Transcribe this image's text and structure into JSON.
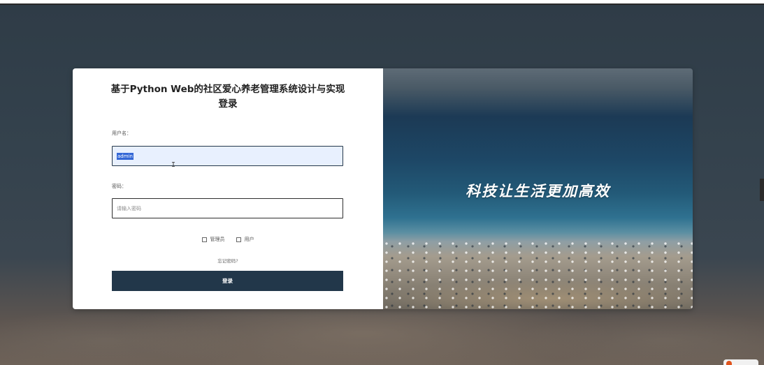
{
  "form": {
    "title": "基于Python Web的社区爱心养老管理系统设计与实现登录",
    "username_label": "用户名：",
    "username_value": "admin",
    "password_label": "密码：",
    "password_placeholder": "请输入密码",
    "roles": [
      {
        "label": "管理员",
        "checked": false
      },
      {
        "label": "用户",
        "checked": false
      }
    ],
    "forgot_password": "忘记密码?",
    "login_button": "登录"
  },
  "banner": {
    "slogan": "科技让生活更加高效"
  },
  "colors": {
    "primary": "#22374a",
    "selection": "#3367d6",
    "autofill": "#e8f0fe"
  }
}
